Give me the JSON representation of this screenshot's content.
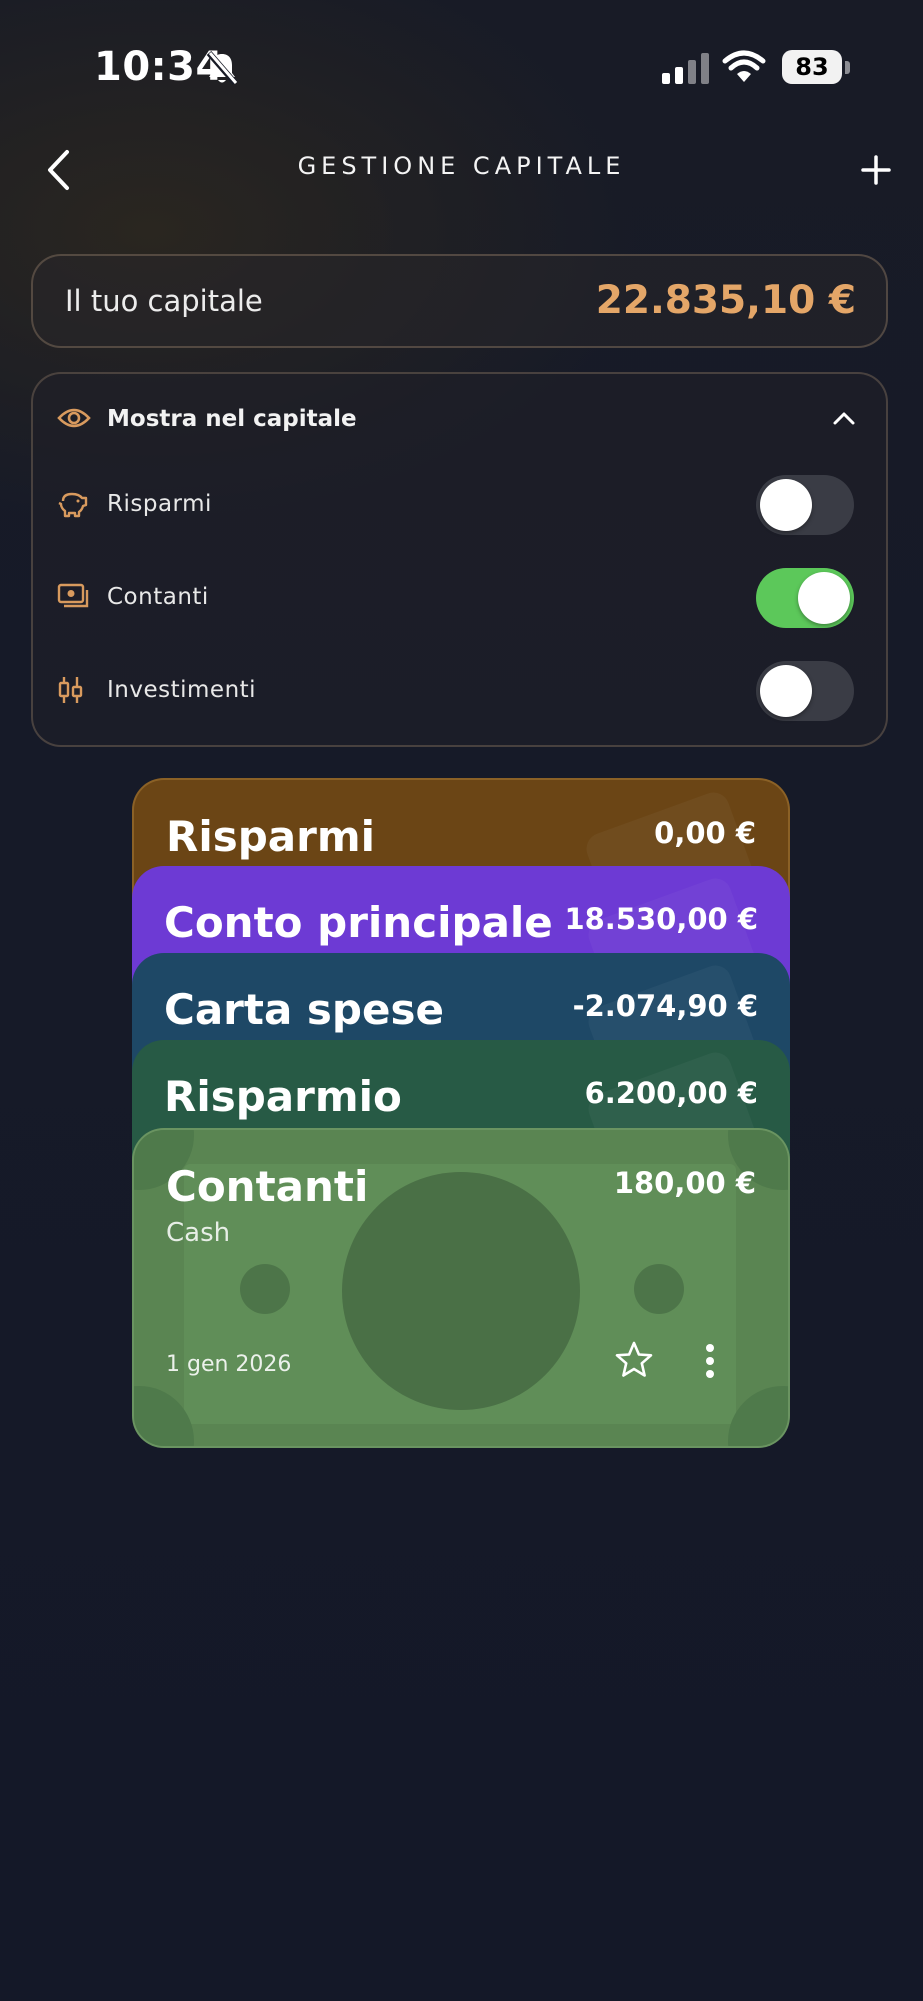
{
  "status_bar": {
    "time": "10:34",
    "battery": "83"
  },
  "header": {
    "title": "GESTIONE CAPITALE"
  },
  "capital": {
    "label": "Il tuo capitale",
    "value": "22.835,10 €"
  },
  "visibility": {
    "title": "Mostra nel capitale",
    "items": [
      {
        "label": "Risparmi",
        "icon": "piggy-bank-icon",
        "enabled": false
      },
      {
        "label": "Contanti",
        "icon": "cash-icon",
        "enabled": true
      },
      {
        "label": "Investimenti",
        "icon": "candlestick-icon",
        "enabled": false
      }
    ]
  },
  "accounts": [
    {
      "name": "Risparmi",
      "amount": "0,00 €",
      "color": "#6b4515"
    },
    {
      "name": "Conto principale",
      "amount": "18.530,00 €",
      "color": "#6d3ad4"
    },
    {
      "name": "Carta spese",
      "amount": "-2.074,90 €",
      "color": "#1e4866"
    },
    {
      "name": "Risparmio",
      "amount": "6.200,00 €",
      "color": "#275a45"
    },
    {
      "name": "Contanti",
      "amount": "180,00 €",
      "subtitle": "Cash",
      "date": "1 gen 2026",
      "color": "#5a8552"
    }
  ],
  "colors": {
    "accent": "#e4a668",
    "toggle_on": "#5cc85a"
  }
}
